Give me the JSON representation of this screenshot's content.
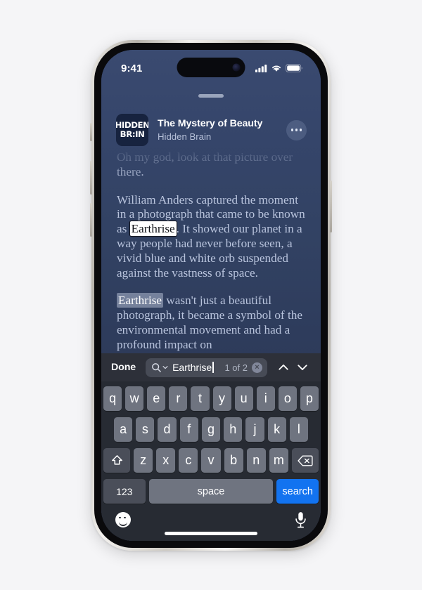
{
  "status_bar": {
    "time": "9:41",
    "cellular_icon": "cellular-bars-icon",
    "wifi_icon": "wifi-icon",
    "battery_icon": "battery-icon"
  },
  "header": {
    "artwork_line1": "HIDDEN",
    "artwork_line2": "BR:IN",
    "episode_title": "The Mystery of Beauty",
    "podcast_name": "Hidden Brain",
    "more_icon": "ellipsis-icon"
  },
  "transcript": {
    "paragraphs": [
      {
        "id": "p1",
        "faded": true,
        "segments": [
          {
            "text": "Oh my god, look at that picture over there.",
            "style": "normal"
          }
        ]
      },
      {
        "id": "p2",
        "faded": false,
        "segments": [
          {
            "text": "William Anders captured the moment in a photograph that came to be known as ",
            "style": "normal"
          },
          {
            "text": "Earthrise",
            "style": "match-active"
          },
          {
            "text": ". It showed our planet in a way people had never before seen, a vivid blue and white orb suspended against the vastness of space.",
            "style": "normal"
          }
        ]
      },
      {
        "id": "p3",
        "faded": false,
        "segments": [
          {
            "text": "Earthrise",
            "style": "match-inactive"
          },
          {
            "text": " wasn't just a beautiful photograph, it became a symbol of the environmental movement and had a profound impact on",
            "style": "normal"
          }
        ]
      }
    ]
  },
  "find_bar": {
    "done_label": "Done",
    "search_icon": "magnifier-icon",
    "scope_chevron_icon": "chevron-down-icon",
    "search_value": "Earthrise",
    "search_placeholder": "Search",
    "match_count": "1 of 2",
    "clear_icon": "clear-circle-icon",
    "clear_glyph": "×",
    "previous_icon": "chevron-up-icon",
    "next_icon": "chevron-down-icon"
  },
  "keyboard": {
    "row1": [
      "q",
      "w",
      "e",
      "r",
      "t",
      "y",
      "u",
      "i",
      "o",
      "p"
    ],
    "row2": [
      "a",
      "s",
      "d",
      "f",
      "g",
      "h",
      "j",
      "k",
      "l"
    ],
    "row3_letters": [
      "z",
      "x",
      "c",
      "v",
      "b",
      "n",
      "m"
    ],
    "shift_icon": "shift-arrow-icon",
    "delete_icon": "backspace-icon",
    "numeric_label": "123",
    "space_label": "space",
    "return_label": "search",
    "emoji_icon": "smiley-face-icon",
    "dictation_icon": "microphone-icon"
  },
  "colors": {
    "page_background": "#f5f5f7",
    "screen_top": "#3a4a70",
    "screen_bottom": "#2a3550",
    "keyboard_background": "#272b33",
    "key_fill": "#6f7480",
    "key_dark_fill": "#4a4e59",
    "accent_blue": "#1273f0",
    "transcript_text": "#b9c4dd",
    "artwork_background": "#17233f"
  }
}
